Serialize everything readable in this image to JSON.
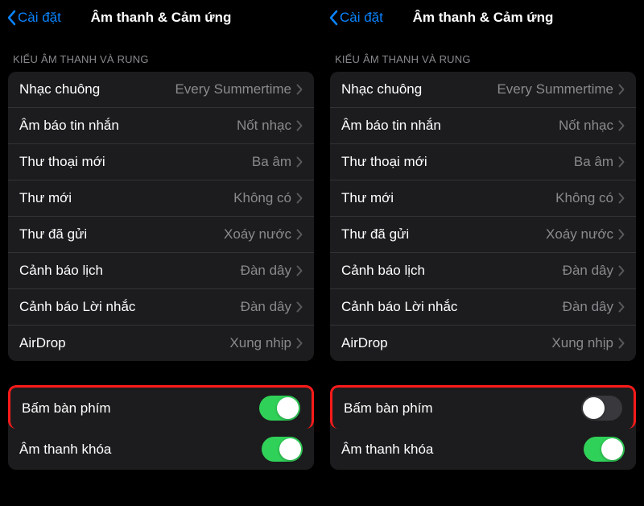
{
  "panes": [
    {
      "back_label": "Cài đặt",
      "title": "Âm thanh & Cảm ứng",
      "section_header": "KIỂU ÂM THANH VÀ RUNG",
      "rows": [
        {
          "label": "Nhạc chuông",
          "value": "Every Summertime",
          "name": "row-ringtone"
        },
        {
          "label": "Âm báo tin nhắn",
          "value": "Nốt nhạc",
          "name": "row-text-tone"
        },
        {
          "label": "Thư thoại mới",
          "value": "Ba âm",
          "name": "row-voicemail"
        },
        {
          "label": "Thư mới",
          "value": "Không có",
          "name": "row-new-mail"
        },
        {
          "label": "Thư đã gửi",
          "value": "Xoáy nước",
          "name": "row-sent-mail"
        },
        {
          "label": "Cảnh báo lịch",
          "value": "Đàn dây",
          "name": "row-calendar-alert"
        },
        {
          "label": "Cảnh báo Lời nhắc",
          "value": "Đàn dây",
          "name": "row-reminder-alert"
        },
        {
          "label": "AirDrop",
          "value": "Xung nhịp",
          "name": "row-airdrop"
        }
      ],
      "toggles": [
        {
          "label": "Bấm bàn phím",
          "on": true,
          "highlight": true,
          "name": "toggle-keyboard-clicks"
        },
        {
          "label": "Âm thanh khóa",
          "on": true,
          "highlight": false,
          "name": "toggle-lock-sound"
        }
      ]
    },
    {
      "back_label": "Cài đặt",
      "title": "Âm thanh & Cảm ứng",
      "section_header": "KIỂU ÂM THANH VÀ RUNG",
      "rows": [
        {
          "label": "Nhạc chuông",
          "value": "Every Summertime",
          "name": "row-ringtone"
        },
        {
          "label": "Âm báo tin nhắn",
          "value": "Nốt nhạc",
          "name": "row-text-tone"
        },
        {
          "label": "Thư thoại mới",
          "value": "Ba âm",
          "name": "row-voicemail"
        },
        {
          "label": "Thư mới",
          "value": "Không có",
          "name": "row-new-mail"
        },
        {
          "label": "Thư đã gửi",
          "value": "Xoáy nước",
          "name": "row-sent-mail"
        },
        {
          "label": "Cảnh báo lịch",
          "value": "Đàn dây",
          "name": "row-calendar-alert"
        },
        {
          "label": "Cảnh báo Lời nhắc",
          "value": "Đàn dây",
          "name": "row-reminder-alert"
        },
        {
          "label": "AirDrop",
          "value": "Xung nhịp",
          "name": "row-airdrop"
        }
      ],
      "toggles": [
        {
          "label": "Bấm bàn phím",
          "on": false,
          "highlight": true,
          "name": "toggle-keyboard-clicks"
        },
        {
          "label": "Âm thanh khóa",
          "on": true,
          "highlight": false,
          "name": "toggle-lock-sound"
        }
      ]
    }
  ]
}
